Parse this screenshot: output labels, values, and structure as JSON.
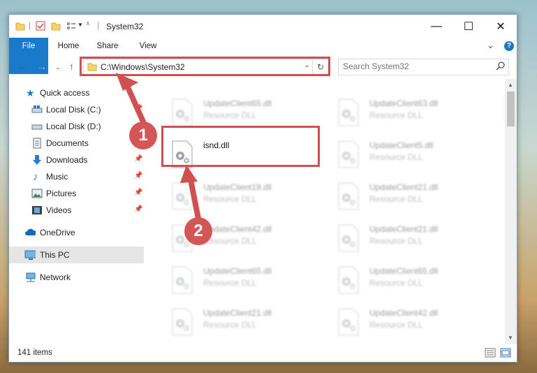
{
  "window": {
    "title": "System32",
    "controls": {
      "minimize": "—",
      "maximize": "☐",
      "close": "✕"
    }
  },
  "ribbon": {
    "tabs": [
      "File",
      "Home",
      "Share",
      "View"
    ],
    "expand": "⌄",
    "help": "?"
  },
  "address": {
    "path": "C:\\Windows\\System32",
    "refresh": "↻"
  },
  "search": {
    "placeholder": "Search System32"
  },
  "nav": {
    "items": [
      {
        "label": "Quick access",
        "icon": "star-icon"
      },
      {
        "label": "Local Disk (C:)",
        "icon": "drive-icon",
        "pinned": true
      },
      {
        "label": "Local Disk (D:)",
        "icon": "drive-icon"
      },
      {
        "label": "Documents",
        "icon": "document-icon",
        "pinned": true
      },
      {
        "label": "Downloads",
        "icon": "download-icon",
        "pinned": true
      },
      {
        "label": "Music",
        "icon": "music-icon",
        "pinned": true
      },
      {
        "label": "Pictures",
        "icon": "picture-icon",
        "pinned": true
      },
      {
        "label": "Videos",
        "icon": "video-icon",
        "pinned": true
      },
      {
        "label": "OneDrive",
        "icon": "cloud-icon"
      },
      {
        "label": "This PC",
        "icon": "computer-icon",
        "selected": true
      },
      {
        "label": "Network",
        "icon": "network-icon"
      }
    ]
  },
  "files": [
    {
      "name": "UpdateClient65.dll",
      "type": "Resource DLL"
    },
    {
      "name": "UpdateClient63.dll",
      "type": "Resource DLL"
    },
    {
      "name": "isnd.dll",
      "type": ""
    },
    {
      "name": "UpdateClient5.dll",
      "type": "Resource DLL"
    },
    {
      "name": "UpdateClient19.dll",
      "type": "Resource DLL"
    },
    {
      "name": "UpdateClient21.dll",
      "type": "Resource DLL"
    },
    {
      "name": "UpdateClient42.dll",
      "type": "Resource DLL"
    },
    {
      "name": "UpdateClient21.dll",
      "type": "Resource DLL"
    },
    {
      "name": "UpdateClient65.dll",
      "type": "Resource DLL"
    },
    {
      "name": "UpdateClient65.dll",
      "type": "Resource DLL"
    },
    {
      "name": "UpdateClient21.dll",
      "type": "Resource DLL"
    },
    {
      "name": "UpdateClient42.dll",
      "type": "Resource DLL"
    }
  ],
  "status": {
    "item_count": "141 items"
  },
  "annotations": {
    "step1": "1",
    "step2": "2",
    "color": "#d05051"
  },
  "colors": {
    "accent": "#1979ca",
    "selection": "#e5e5e5"
  }
}
